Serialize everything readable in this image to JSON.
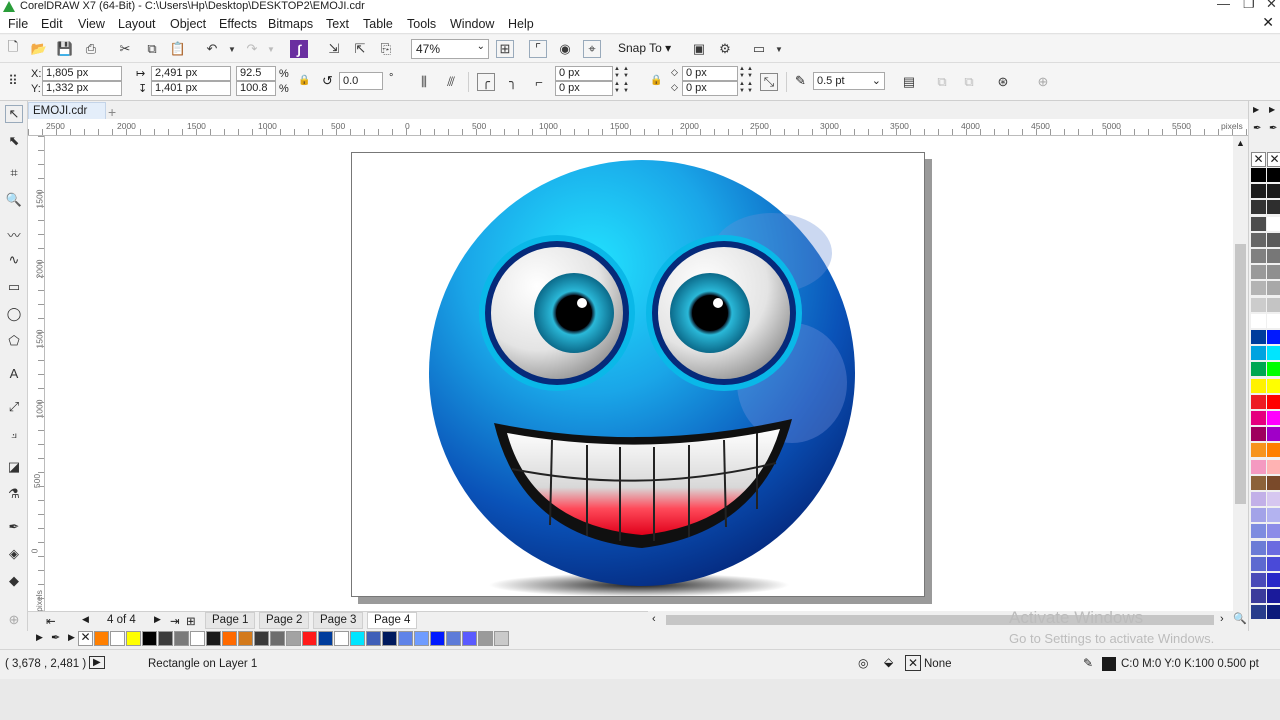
{
  "app": {
    "title": "CorelDRAW X7 (64-Bit) - C:\\Users\\Hp\\Desktop\\DESKTOP2\\EMOJI.cdr"
  },
  "menu": {
    "items": [
      "File",
      "Edit",
      "View",
      "Layout",
      "Object",
      "Effects",
      "Bitmaps",
      "Text",
      "Table",
      "Tools",
      "Window",
      "Help"
    ]
  },
  "toolbar": {
    "zoom": "47%",
    "snap_to": "Snap To"
  },
  "properties": {
    "x": "1,805 px",
    "y": "1,332 px",
    "width": "2,491 px",
    "height": "1,401 px",
    "scale_x": "92.5",
    "scale_y": "100.8",
    "percent": "%",
    "rotation": "0.0",
    "degree": "°",
    "corner1": "0 px",
    "corner2": "0 px",
    "corner3": "0 px",
    "corner4": "0 px",
    "outline_width": "0.5 pt"
  },
  "document_tab": {
    "name": "EMOJI.cdr"
  },
  "rulers": {
    "h_labels": [
      "2500",
      "2000",
      "1500",
      "1000",
      "500",
      "0",
      "500",
      "1000",
      "1500",
      "2000",
      "2500",
      "3000",
      "3500",
      "4000",
      "4500",
      "5000",
      "5500"
    ],
    "h_unit": "pixels",
    "v_labels": [
      "1500",
      "2000",
      "1500",
      "1000",
      "500",
      "0"
    ],
    "v_unit": "pixels"
  },
  "page_nav": {
    "counter": "4 of 4",
    "pages": [
      "Page 1",
      "Page 2",
      "Page 3",
      "Page 4"
    ],
    "active": "Page 4"
  },
  "doc_palette_colors": [
    "#ff7f00",
    "#ffffff",
    "#ffff00",
    "#000000",
    "#3b3b3b",
    "#7a7a7a",
    "#ffffff",
    "#1a1a1a",
    "#ff6a00",
    "#d37a1c",
    "#3a3a3a",
    "#6d6d6d",
    "#a3a3a3",
    "#ff1a1a",
    "#003c9c",
    "#ffffff",
    "#00e5ff",
    "#3f5fb8",
    "#001a5e",
    "#5f83e8",
    "#6f9cff",
    "#0019ff",
    "#5d7bd8",
    "#5b5bff",
    "#9a9a9a",
    "#cacaca"
  ],
  "right_palette": {
    "col1": [
      "#000000",
      "#1c1c1c",
      "#333333",
      "#4d4d4d",
      "#666666",
      "#808080",
      "#999999",
      "#b3b3b3",
      "#cccccc",
      "#ffffff",
      "#003c9c",
      "#00a3e0",
      "#00a651",
      "#fff200",
      "#ed1c24",
      "#e5007e",
      "#9e005d",
      "#f7941d",
      "#f49ac1",
      "#8c6239",
      "#c2b0e8",
      "#a3a3e8",
      "#7e8ce0",
      "#6b7bd6",
      "#5d6ad0",
      "#4a4ab8",
      "#3b3b9b",
      "#283c8c"
    ],
    "col2": [
      "#000000",
      "#1a1a1a",
      "#2e2e2e",
      "#ffffff",
      "#5a5a5a",
      "#777777",
      "#8f8f8f",
      "#a8a8a8",
      "#c4c4c4",
      "#ffffff",
      "#0019ff",
      "#00e5ff",
      "#00ff00",
      "#ffff00",
      "#ff0000",
      "#ff00ff",
      "#a000c8",
      "#ff7f00",
      "#ffb3b3",
      "#7a4a2a",
      "#d6c7f0",
      "#b3b3f0",
      "#8c8ce8",
      "#6b6be0",
      "#4a4ad8",
      "#2929c8",
      "#1a1a9b",
      "#0c1a7a"
    ]
  },
  "status": {
    "coords": "( 3,678 , 2,481 )",
    "selection": "Rectangle on Layer 1",
    "fill": "None",
    "outline": "C:0 M:0 Y:0 K:100  0.500 pt"
  },
  "watermark": {
    "line1": "Activate Windows",
    "line2": "Go to Settings to activate Windows."
  }
}
